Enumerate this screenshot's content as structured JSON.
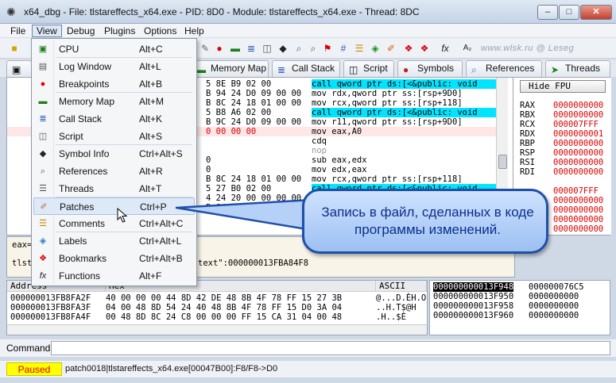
{
  "window": {
    "title": "x64_dbg - File: tlstareffects_x64.exe - PID: 8D0 - Module: tlstareffects_x64.exe - Thread: 8DC",
    "minimize": "–",
    "maximize": "□",
    "close": "✕"
  },
  "menubar": [
    "File",
    "View",
    "Debug",
    "Plugins",
    "Options",
    "Help"
  ],
  "toolbar": {
    "watermark": "www.wlsk.ru @ Leseg"
  },
  "tabs": [
    "Memory Map",
    "Call Stack",
    "Script",
    "Symbols",
    "References",
    "Threads"
  ],
  "view_menu": {
    "items": [
      {
        "label": "CPU",
        "shortcut": "Alt+C",
        "icon": "cpu-icon"
      },
      {
        "label": "Log Window",
        "shortcut": "Alt+L",
        "icon": "log-icon"
      },
      {
        "label": "Breakpoints",
        "shortcut": "Alt+B",
        "icon": "breakpoint-icon"
      },
      {
        "label": "Memory Map",
        "shortcut": "Alt+M",
        "icon": "memory-map-icon"
      },
      {
        "label": "Call Stack",
        "shortcut": "Alt+K",
        "icon": "call-stack-icon"
      },
      {
        "label": "Script",
        "shortcut": "Alt+S",
        "icon": "script-icon"
      },
      {
        "label": "Symbol Info",
        "shortcut": "Ctrl+Alt+S",
        "icon": "symbol-info-icon"
      },
      {
        "label": "References",
        "shortcut": "Alt+R",
        "icon": "references-icon"
      },
      {
        "label": "Threads",
        "shortcut": "Alt+T",
        "icon": "threads-icon"
      },
      {
        "label": "Patches",
        "shortcut": "Ctrl+P",
        "icon": "patches-icon"
      },
      {
        "label": "Comments",
        "shortcut": "Ctrl+Alt+C",
        "icon": "comments-icon"
      },
      {
        "label": "Labels",
        "shortcut": "Ctrl+Alt+L",
        "icon": "labels-icon"
      },
      {
        "label": "Bookmarks",
        "shortcut": "Ctrl+Alt+B",
        "icon": "bookmarks-icon"
      },
      {
        "label": "Functions",
        "shortcut": "Alt+F",
        "icon": "functions-icon"
      }
    ]
  },
  "disasm": [
    {
      "bytes": "5 8E B9 02 00",
      "instr": "call qword ptr ds:[<&public: void",
      "kind": "call"
    },
    {
      "bytes": "B 94 24 D0 09 00 00",
      "instr": "mov rdx,qword ptr ss:[rsp+9D0]",
      "kind": ""
    },
    {
      "bytes": "B 8C 24 18 01 00 00",
      "instr": "mov rcx,qword ptr ss:[rsp+118]",
      "kind": ""
    },
    {
      "bytes": "5 B8 A6 02 00",
      "instr": "call qword ptr ds:[<&public: void",
      "kind": "call"
    },
    {
      "bytes": "B 9C 24 D0 09 00 00",
      "instr": "mov r11,qword ptr ss:[rsp+9D0]",
      "kind": ""
    },
    {
      "bytes": "0 00 00 00",
      "instr": "mov eax,A0",
      "kind": "sel"
    },
    {
      "bytes": "",
      "instr": "cdq",
      "kind": ""
    },
    {
      "bytes": "",
      "instr": "nop",
      "kind": "nop"
    },
    {
      "bytes": "0",
      "instr": "sub eax,edx",
      "kind": ""
    },
    {
      "bytes": "0",
      "instr": "mov edx,eax",
      "kind": ""
    },
    {
      "bytes": "B 8C 24 18 01 00 00",
      "instr": "mov rcx,qword ptr ss:[rsp+118]",
      "kind": ""
    },
    {
      "bytes": "5 27 B0 02 00",
      "instr": "call qword ptr ds:[<&public: void",
      "kind": "call"
    },
    {
      "bytes": "4 24 20 00 00 00 00",
      "instr": "",
      "kind": ""
    },
    {
      "bytes": "B 84 24 18 01 00 00",
      "instr": "",
      "kind": ""
    }
  ],
  "registers": {
    "hide_fpu": "Hide FPU",
    "list": [
      {
        "name": "RAX",
        "value": "0000000000"
      },
      {
        "name": "RBX",
        "value": "0000000000"
      },
      {
        "name": "RCX",
        "value": "000007FFF"
      },
      {
        "name": "RDX",
        "value": "0000000001"
      },
      {
        "name": "RBP",
        "value": "0000000000"
      },
      {
        "name": "RSP",
        "value": "0000000000"
      },
      {
        "name": "RSI",
        "value": "0000000000"
      },
      {
        "name": "RDI",
        "value": "0000000000"
      },
      {
        "name": "",
        "value": ""
      },
      {
        "name": "",
        "value": "000007FFF"
      },
      {
        "name": "",
        "value": "0000000000"
      },
      {
        "name": "",
        "value": "0000000000"
      },
      {
        "name": "",
        "value": "0000000000"
      },
      {
        "name": "",
        "value": "0000000000"
      },
      {
        "name": "",
        "value": "0000000000"
      },
      {
        "name": "",
        "value": "0000000000"
      },
      {
        "name": "R15",
        "value": "0000000000"
      }
    ]
  },
  "info": {
    "line1": "eax=",
    "line2": "tlst",
    "line2_tail": "text\":000000013FBA84F8"
  },
  "dump": {
    "headers": {
      "address": "Address",
      "hex": "Hex",
      "ascii": "ASCII"
    },
    "rows": [
      {
        "address": "000000013FB8FA2F",
        "hex": "40 00 00 00 44 8D 42 DE 48 8B 4F 78 FF 15 27 3B",
        "ascii": "@...D.ÈH.Oxy.'"
      },
      {
        "address": "000000013FB8FA3F",
        "hex": "04 00 48 8D 54 24 40 48 8B 4F 78 FF 15 D0 3A 04",
        "ascii": "..H.T$@H"
      },
      {
        "address": "000000013FB8FA4F",
        "hex": "00 48 8D 8C 24 C8 00 00 00 FF 15 CA 31 04 00 48",
        "ascii": ".H..$È"
      }
    ]
  },
  "stack": {
    "rows": [
      {
        "address": "000000000013F948",
        "value": "000000076C5",
        "selected": true
      },
      {
        "address": "000000000013F950",
        "value": "0000000000",
        "selected": false
      },
      {
        "address": "000000000013F958",
        "value": "0000000000",
        "selected": false
      },
      {
        "address": "000000000013F960",
        "value": "0000000000",
        "selected": false
      }
    ]
  },
  "command": {
    "label": "Command:",
    "value": ""
  },
  "status": {
    "state": "Paused",
    "message": "patch0018|tlstareffects_x64.exe[00047B00]:F8/F8->D0"
  },
  "callout": {
    "text": "Запись в файл, сделанных в коде программы изменений."
  },
  "colors": {
    "call_highlight": "#00e4ff",
    "status_yellow": "#ffff00",
    "register_red": "#e00000",
    "callout_border": "#1f4fa8"
  }
}
